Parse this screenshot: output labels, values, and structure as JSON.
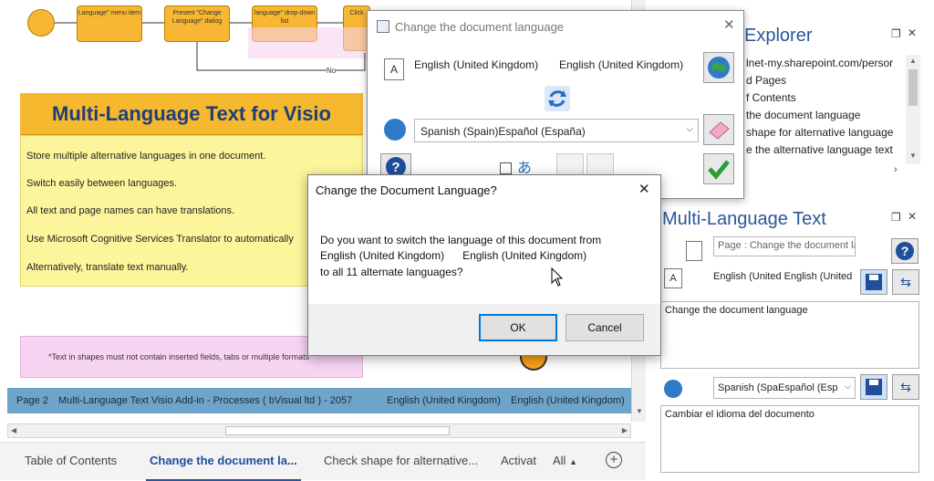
{
  "canvas": {
    "flow_steps": [
      "Language\" menu item",
      "Present \"Change Language\" dialog",
      "language\" drop-down list",
      "Click"
    ],
    "no_label": "No",
    "banner_title": "Multi-Language Text for Visio",
    "lines": [
      "Store multiple alternative languages in one document.",
      "Switch easily between languages.",
      "All text and page names can have translations.",
      "Use Microsoft Cognitive Services Translator to automatically",
      "Alternatively, translate text manually."
    ],
    "note": "*Text in shapes must not contain inserted fields, tabs or multiple formats",
    "status": {
      "page": "Page 2",
      "doc": "Multi-Language Text Visio Add-in - Processes ( bVisual ltd ) - 2057",
      "lang1": "English (United Kingdom)",
      "lang2": "English (United Kingdom)"
    }
  },
  "tabs": {
    "items": [
      "Table of Contents",
      "Change the document la...",
      "Check shape for alternative...",
      "Activat"
    ],
    "all_label": "All"
  },
  "explorer": {
    "title": "Explorer",
    "items": [
      "lnet-my.sharepoint.com/persor",
      "d Pages",
      "f Contents",
      "the document language",
      "shape for alternative language",
      "e the alternative language text"
    ]
  },
  "mlt": {
    "title": "Multi-Language Text",
    "page_field": "Page : Change the document la",
    "lang_pair": "English (United  English (United",
    "text_en": "Change the document language",
    "spanish_select": "Spanish (SpaEspañol (Esp",
    "text_es": "Cambiar el idioma del documento"
  },
  "dialog_change_lang": {
    "title": "Change the document language",
    "current_lang": "English (United Kingdom)",
    "current_native": "English (United Kingdom)",
    "target_select": "Spanish (Spain)Español (España)"
  },
  "dialog_confirm": {
    "title": "Change the Document Language?",
    "line1": "Do you want to switch the language of this document from",
    "line2": "English (United Kingdom)      English (United Kingdom)",
    "line3": "to all 11 alternate languages?",
    "ok": "OK",
    "cancel": "Cancel"
  },
  "icons": [
    "close-icon",
    "refresh-icon",
    "globe-icon",
    "eraser-icon",
    "check-icon",
    "help-icon",
    "save-icon",
    "swap-icon",
    "add-icon"
  ]
}
